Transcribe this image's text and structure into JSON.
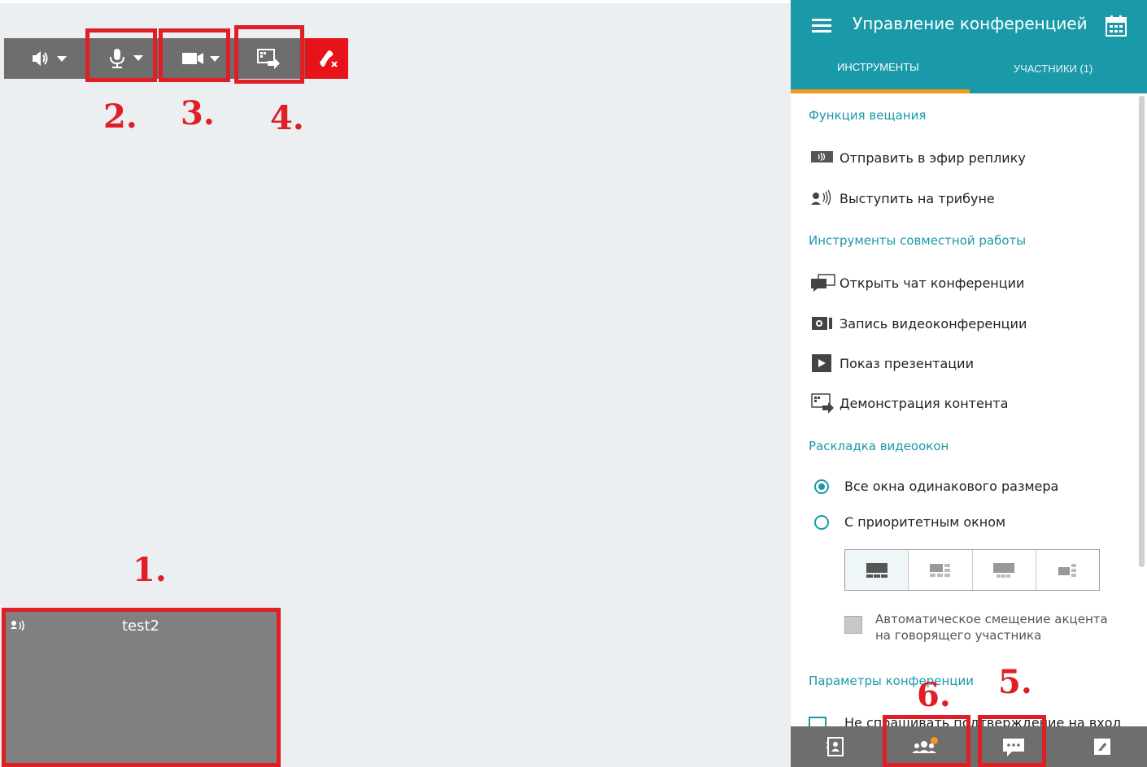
{
  "toolbar": {
    "speaker_icon": "speaker-icon",
    "mic_icon": "microphone-icon",
    "camera_icon": "camera-icon",
    "share_icon": "screen-share-icon",
    "hangup_icon": "hangup-icon"
  },
  "annotations": {
    "n1": "1.",
    "n2": "2.",
    "n3": "3.",
    "n4": "4.",
    "n5": "5.",
    "n6": "6.",
    "color": "#e01e26"
  },
  "tile": {
    "name": "test2"
  },
  "panel": {
    "title": "Управление конференцией",
    "tabs": [
      {
        "label": "ИНСТРУМЕНТЫ",
        "active": true
      },
      {
        "label": "УЧАСТНИКИ (1)",
        "active": false
      }
    ],
    "sections": {
      "broadcast": "Функция вещания",
      "collab": "Инструменты совместной работы",
      "layout": "Раскладка видеоокон",
      "params": "Параметры конференции"
    },
    "items": {
      "send_reply": "Отправить в эфир реплику",
      "tribune": "Выступить на трибуне",
      "chat": "Открыть чат конференции",
      "record": "Запись видеоконференции",
      "presentation": "Показ презентации",
      "content": "Демонстрация контента"
    },
    "layout_options": {
      "equal": "Все окна одинакового размера",
      "priority": "С приоритетным окном"
    },
    "auto_focus": "Автоматическое смещение акцента на говорящего участника",
    "params_first": "Не спрашивать подтверждение на вход"
  },
  "colors": {
    "accent": "#1a9aa8",
    "tab_indicator": "#f39a1d",
    "hangup": "#e8121b",
    "bar": "#6e6e6e"
  }
}
